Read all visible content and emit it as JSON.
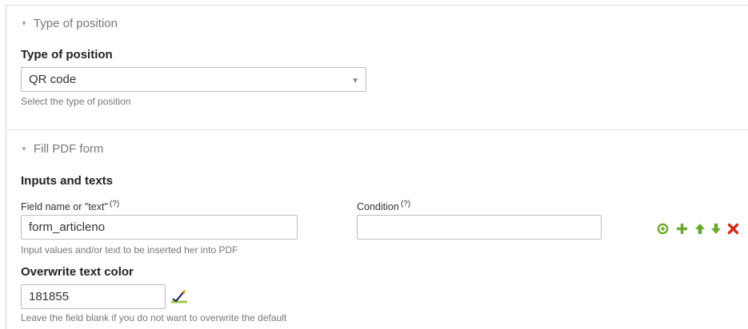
{
  "type_of_position_section": {
    "header": "Type of position",
    "field_label": "Type of position",
    "selected_value": "QR code",
    "help_text": "Select the type of position"
  },
  "fill_pdf_section": {
    "header": "Fill PDF form",
    "inputs_heading": "Inputs and texts",
    "field_name_label": "Field name or \"text\"",
    "field_name_help_marker": "(?)",
    "field_name_value": "form_articleno",
    "field_name_help_text": "Input values and/or text to be inserted her into PDF",
    "condition_label": "Condition",
    "condition_help_marker": "(?)",
    "condition_value": "",
    "overwrite_color_label": "Overwrite text color",
    "overwrite_color_value": "181855",
    "overwrite_color_help_text": "Leave the field blank if you do not want to overwrite the default"
  },
  "row_actions": {
    "icons": [
      "add-circle-icon",
      "plus-icon",
      "arrow-up-icon",
      "arrow-down-icon",
      "delete-icon"
    ],
    "green_color": "#6aa82d",
    "red_color": "#d52b1e"
  },
  "color_picker": {
    "icon": "color-picker-icon",
    "stroke_color": "#181855",
    "accent_color": "#9cc94a"
  }
}
